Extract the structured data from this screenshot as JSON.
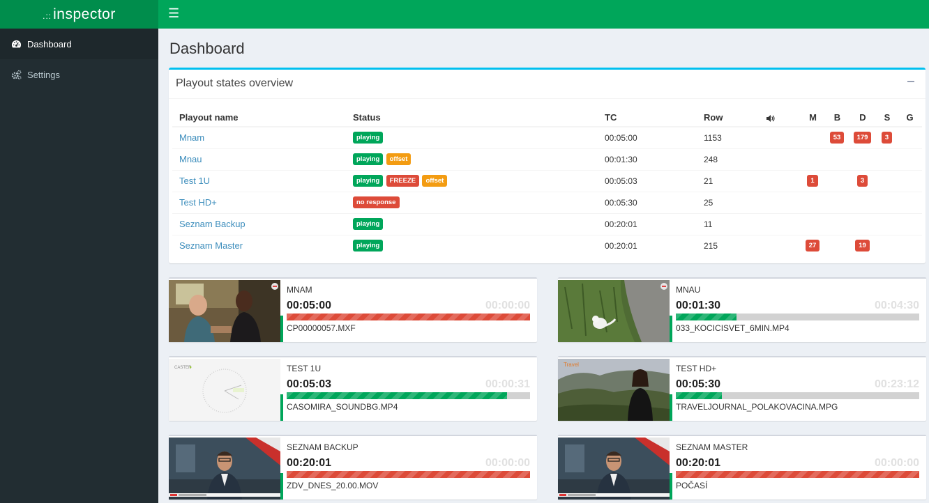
{
  "app": {
    "logo_dots": ".::",
    "logo_text": "inspector"
  },
  "sidebar": {
    "items": [
      {
        "label": "Dashboard",
        "icon": "dashboard-icon",
        "active": true
      },
      {
        "label": "Settings",
        "icon": "gears-icon",
        "active": false
      }
    ]
  },
  "page": {
    "title": "Dashboard"
  },
  "overview": {
    "title": "Playout states overview",
    "columns": {
      "name": "Playout name",
      "status": "Status",
      "tc": "TC",
      "row": "Row",
      "audio_icon": "volume-icon",
      "m": "M",
      "b": "B",
      "d": "D",
      "s": "S",
      "g": "G"
    },
    "rows": [
      {
        "name": "Mnam",
        "status": [
          {
            "text": "playing",
            "color": "#00a65a"
          }
        ],
        "tc": "00:05:00",
        "row": "1153",
        "m": "",
        "b": "53",
        "d": "179",
        "s": "3",
        "g": ""
      },
      {
        "name": "Mnau",
        "status": [
          {
            "text": "playing",
            "color": "#00a65a"
          },
          {
            "text": "offset",
            "color": "#f39c12"
          }
        ],
        "tc": "00:01:30",
        "row": "248",
        "m": "",
        "b": "",
        "d": "",
        "s": "",
        "g": ""
      },
      {
        "name": "Test 1U",
        "status": [
          {
            "text": "playing",
            "color": "#00a65a"
          },
          {
            "text": "FREEZE",
            "color": "#dd4b39"
          },
          {
            "text": "offset",
            "color": "#f39c12"
          }
        ],
        "tc": "00:05:03",
        "row": "21",
        "m": "1",
        "b": "",
        "d": "3",
        "s": "",
        "g": ""
      },
      {
        "name": "Test HD+",
        "status": [
          {
            "text": "no response",
            "color": "#dd4b39"
          }
        ],
        "tc": "00:05:30",
        "row": "25",
        "m": "",
        "b": "",
        "d": "",
        "s": "",
        "g": ""
      },
      {
        "name": "Seznam Backup",
        "status": [
          {
            "text": "playing",
            "color": "#00a65a"
          }
        ],
        "tc": "00:20:01",
        "row": "11",
        "m": "",
        "b": "",
        "d": "",
        "s": "",
        "g": ""
      },
      {
        "name": "Seznam Master",
        "status": [
          {
            "text": "playing",
            "color": "#00a65a"
          }
        ],
        "tc": "00:20:01",
        "row": "215",
        "m": "27",
        "b": "",
        "d": "19",
        "s": "",
        "g": ""
      }
    ]
  },
  "tiles": [
    {
      "name": "MNAM",
      "tc": "00:05:00",
      "remaining": "00:00:00",
      "progress": 1.0,
      "bar_color": "red",
      "file": "CP00000057.MXF",
      "thumb": "kitchen-scene"
    },
    {
      "name": "MNAU",
      "tc": "00:01:30",
      "remaining": "00:04:30",
      "progress": 0.25,
      "bar_color": "green",
      "file": "033_KOCICISVET_6MIN.MP4",
      "thumb": "cat-on-grass"
    },
    {
      "name": "TEST 1U",
      "tc": "00:05:03",
      "remaining": "00:00:31",
      "progress": 0.906,
      "bar_color": "green",
      "file": "CASOMIRA_SOUNDBG.MP4",
      "thumb": "clock-scene",
      "thumb_logo": "CASTER"
    },
    {
      "name": "TEST HD+",
      "tc": "00:05:30",
      "remaining": "00:23:12",
      "progress": 0.19,
      "bar_color": "green",
      "file": "TRAVELJOURNAL_POLAKOVACINA.MPG",
      "thumb": "hills-woman",
      "thumb_logo": "Travel"
    },
    {
      "name": "SEZNAM BACKUP",
      "tc": "00:20:01",
      "remaining": "00:00:00",
      "progress": 1.0,
      "bar_color": "red",
      "file": "ZDV_DNES_20.00.MOV",
      "thumb": "news-anchor"
    },
    {
      "name": "SEZNAM MASTER",
      "tc": "00:20:01",
      "remaining": "00:00:00",
      "progress": 1.0,
      "bar_color": "red",
      "file": "POČASÍ",
      "thumb": "news-anchor"
    }
  ]
}
